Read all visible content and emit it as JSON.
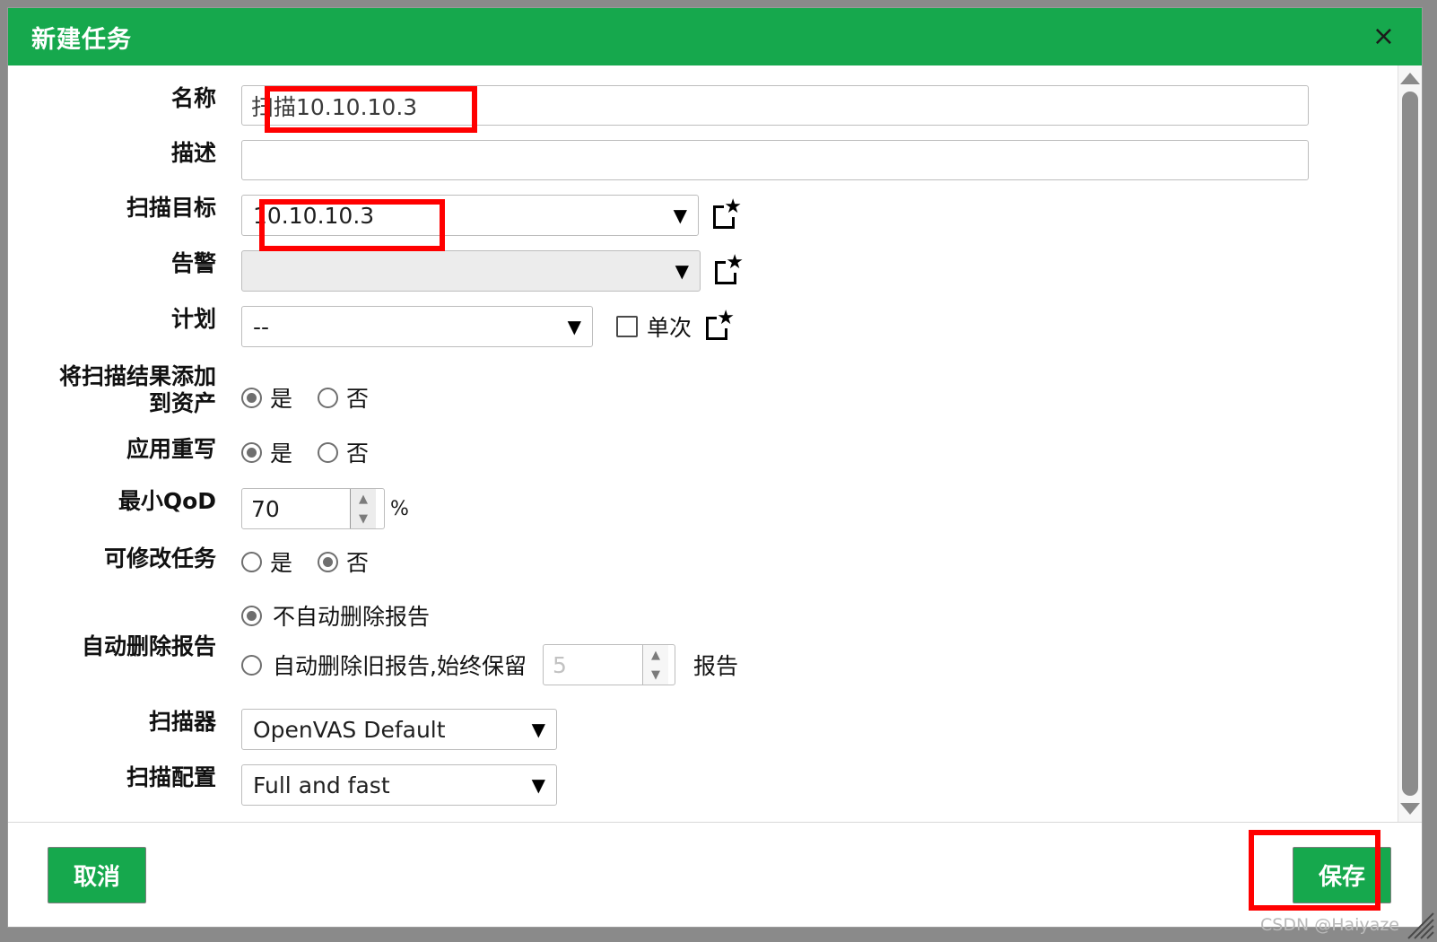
{
  "window": {
    "title": "新建任务",
    "close_label": "×"
  },
  "colors": {
    "accent_green": "#16a84d",
    "annotation_red": "#ff0000",
    "desktop_gray": "#8a8a8a",
    "border_gray": "#bdbdbd",
    "disabled_bg": "#ececec"
  },
  "form": {
    "name": {
      "label": "名称",
      "value": "扫描10.10.10.3",
      "placeholder": ""
    },
    "description": {
      "label": "描述",
      "value": "",
      "placeholder": ""
    },
    "scan_target": {
      "label": "扫描目标",
      "value": "10.10.10.3",
      "new_icon": "new-document-star-icon"
    },
    "alert": {
      "label": "告警",
      "value": "",
      "disabled": true,
      "new_icon": "new-document-star-icon"
    },
    "schedule": {
      "label": "计划",
      "value": "--",
      "once_label": "单次",
      "once_checked": false,
      "new_icon": "new-document-star-icon"
    },
    "add_results_to_assets": {
      "label": "将扫描结果添加到资产",
      "label_line1": "将扫描结果添加",
      "label_line2": "到资产",
      "options": [
        "是",
        "否"
      ],
      "selected": "是"
    },
    "apply_overrides": {
      "label": "应用重写",
      "options": [
        "是",
        "否"
      ],
      "selected": "是"
    },
    "min_qod": {
      "label": "最小QoD",
      "value": "70",
      "unit": "%"
    },
    "alterable_task": {
      "label": "可修改任务",
      "options": [
        "是",
        "否"
      ],
      "selected": "否"
    },
    "auto_delete_reports": {
      "label": "自动删除报告",
      "option_no_delete": "不自动删除报告",
      "option_auto_delete": "自动删除旧报告,始终保留",
      "selected": "不自动删除报告",
      "keep_count_placeholder": "5",
      "keep_count_value": "",
      "reports_suffix": "报告"
    },
    "scanner": {
      "label": "扫描器",
      "value": "OpenVAS Default"
    },
    "scan_config": {
      "label": "扫描配置",
      "value": "Full and fast"
    }
  },
  "footer": {
    "cancel_label": "取消",
    "save_label": "保存"
  },
  "watermark": {
    "text": "CSDN @Haiyaze"
  },
  "icons": {
    "caret_down": "▼",
    "spin_up": "▲",
    "spin_down": "▼"
  }
}
